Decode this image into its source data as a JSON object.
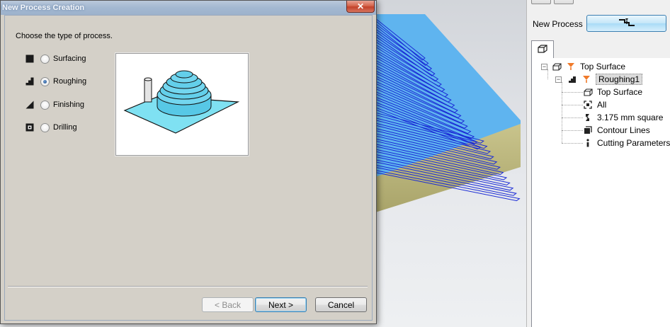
{
  "dialog": {
    "title": "New Process Creation",
    "close_glyph": "✕",
    "prompt": "Choose the type of process.",
    "options": [
      {
        "label": "Surfacing",
        "icon": "surfacing-icon",
        "checked": false
      },
      {
        "label": "Roughing",
        "icon": "roughing-icon",
        "checked": true
      },
      {
        "label": "Finishing",
        "icon": "finishing-icon",
        "checked": false
      },
      {
        "label": "Drilling",
        "icon": "drilling-icon",
        "checked": false
      }
    ],
    "buttons": {
      "back": "< Back",
      "next": "Next >",
      "cancel": "Cancel"
    }
  },
  "side_panel": {
    "new_process_label": "New Process",
    "new_process_icon": "new-process-icon",
    "tree": {
      "root": {
        "label": "Top Surface",
        "icon": "stock-box-icon"
      },
      "process": {
        "label": "Roughing1",
        "icon": "roughing-icon"
      },
      "children": [
        {
          "label": "Top Surface",
          "icon": "stock-box-icon"
        },
        {
          "label": "All",
          "icon": "boundary-icon"
        },
        {
          "label": "3.175 mm square",
          "icon": "tool-icon"
        },
        {
          "label": "Contour Lines",
          "icon": "strategy-icon"
        },
        {
          "label": "Cutting Parameters",
          "icon": "parameters-icon"
        }
      ]
    }
  },
  "colors": {
    "accent_blue": "#3c7fb1",
    "toolpath_blue": "#1a2bd6",
    "stock_top": "#5fb4ef",
    "stock_side": "#b9b57a",
    "preview_plate": "#7fe1f2"
  }
}
